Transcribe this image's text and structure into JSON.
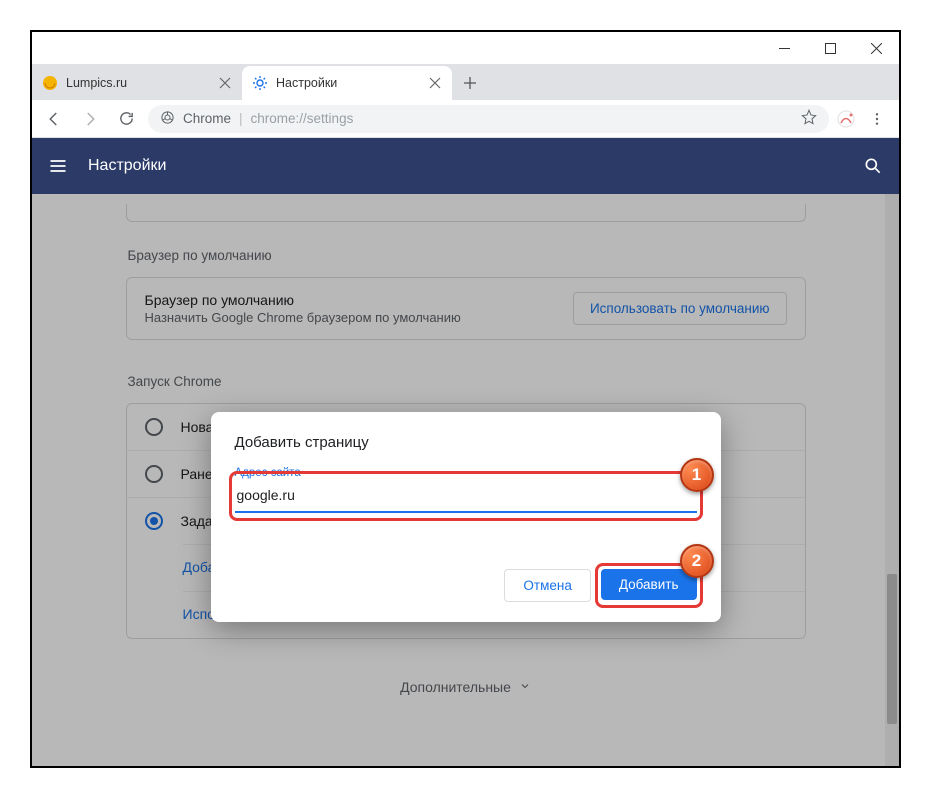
{
  "tabs": [
    {
      "title": "Lumpics.ru"
    },
    {
      "title": "Настройки"
    }
  ],
  "omnibox": {
    "origin": "Chrome",
    "path": "chrome://settings"
  },
  "settings_header": {
    "title": "Настройки"
  },
  "sections": {
    "default_browser": {
      "heading": "Браузер по умолчанию",
      "title": "Браузер по умолчанию",
      "subtitle": "Назначить Google Chrome браузером по умолчанию",
      "button": "Использовать по умолчанию"
    },
    "startup": {
      "heading": "Запуск Chrome",
      "options": [
        {
          "label": "Новая вкладка",
          "short": "Нова"
        },
        {
          "label": "Ранее открытые вкладки",
          "short": "Ране"
        },
        {
          "label": "Заданные страницы",
          "short": "Зада"
        }
      ],
      "add_page_link": "Добавить страницу",
      "use_current_link": "Использовать текущие страницы"
    },
    "advanced": "Дополнительные"
  },
  "dialog": {
    "title": "Добавить страницу",
    "field_label": "Адрес сайта",
    "field_value": "google.ru",
    "cancel": "Отмена",
    "add": "Добавить"
  },
  "callouts": {
    "one": "1",
    "two": "2"
  }
}
